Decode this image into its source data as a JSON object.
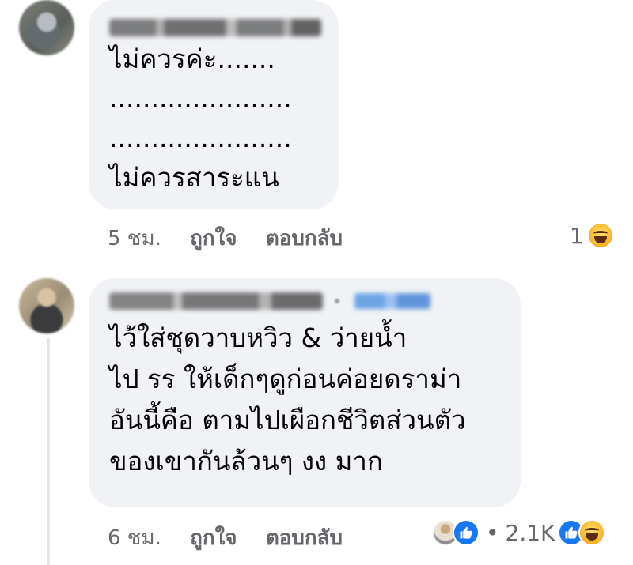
{
  "comments": [
    {
      "author": "",
      "lines": [
        "ไม่ควรค่ะ.......",
        "......................",
        "......................",
        "ไม่ควรสาระแน"
      ],
      "time": "5 ชม.",
      "like_label": "ถูกใจ",
      "reply_label": "ตอบกลับ",
      "reaction_count": "1",
      "reaction_icons": [
        "haha-icon"
      ]
    },
    {
      "author": "",
      "badge": "",
      "lines": [
        "ไว้ใส่ชุดวาบหวิว & ว่ายน้ำ",
        "ไป รร ให้เด็กๆดูก่อนค่อยดราม่า",
        "อันนี้คือ ตามไปเผือกชีวิตส่วนตัว",
        "ของเขากันล้วนๆ งง มาก"
      ],
      "time": "6 ชม.",
      "like_label": "ถูกใจ",
      "reply_label": "ตอบกลับ",
      "reaction_count": "2.1K",
      "separator": "•",
      "reaction_icons": [
        "like-icon",
        "haha-icon"
      ]
    }
  ],
  "colors": {
    "bubble": "#f0f2f5",
    "meta_text": "#65676b",
    "like_blue": "#1877f2",
    "haha_yellow": "#f7b125"
  }
}
